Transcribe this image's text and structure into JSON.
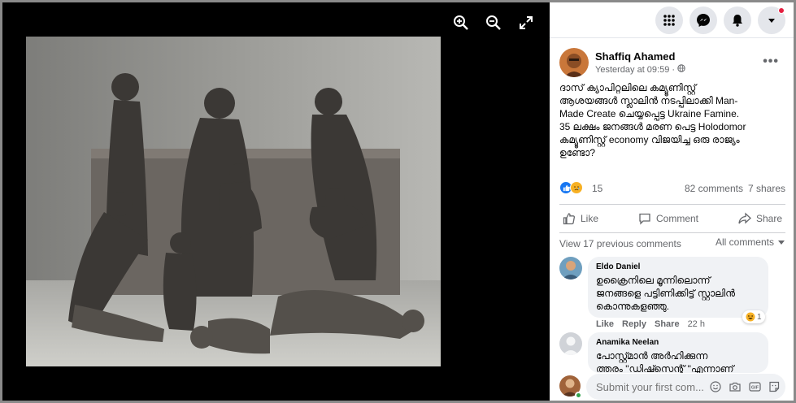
{
  "viewer": {
    "tools": [
      "zoom-in-icon",
      "zoom-out-icon",
      "fullscreen-icon"
    ]
  },
  "topbar": {
    "buttons": [
      "menu-grid-icon",
      "messenger-icon",
      "notifications-bell-icon",
      "account-dropdown-icon"
    ]
  },
  "post": {
    "author": "Shaffiq Ahamed",
    "time": "Yesterday at 09:59 ·",
    "text_lines": [
      "ദാസ് ക്യാപിറ്റലിലെ കമ്യൂണിസ്റ്റ്",
      "ആശയങ്ങൾ സ്ലാലിൻ നടപ്പിലാക്കി Man-",
      "Made Create ചെയ്യപ്പെട്ട Ukraine Famine.",
      "35 ലക്ഷം ജനങ്ങൾ മരണ പെട്ട Holodomor",
      "കമ്യൂണിസ്റ്റ് economy വിജയിച്ച ഒരു രാജ്യം",
      "ഉണ്ടോ?"
    ],
    "reaction_count": "15",
    "comments_count": "82 comments",
    "shares_count": "7 shares",
    "actions": {
      "like": "Like",
      "comment": "Comment",
      "share": "Share"
    }
  },
  "comments_bar": {
    "view_previous": "View 17 previous comments",
    "filter": "All comments"
  },
  "comments": [
    {
      "name": "Eldo Daniel",
      "lines": [
        "ഉക്രൈനിലെ മൂന്നിലൊന്ന്",
        "ജനങ്ങളെ പട്ടിണിക്കിട്ട് സ്റ്റാലിൻ",
        "കൊന്നുകളഞ്ഞു."
      ],
      "like": "Like",
      "reply": "Reply",
      "share": "Share",
      "time": "22 h",
      "reaction_count": "1"
    },
    {
      "name": "Anamika Neelan",
      "lines": [
        "പോസ്റ്റ്മാൻ അർഹിക്കുന്ന",
        "ത്തരം \"ഡിഷ്സെന്റ് \"എന്നാണ്"
      ]
    }
  ],
  "composer": {
    "placeholder": "Submit your first com...",
    "icons": [
      "emoji-icon",
      "camera-icon",
      "gif-icon",
      "sticker-icon"
    ]
  }
}
